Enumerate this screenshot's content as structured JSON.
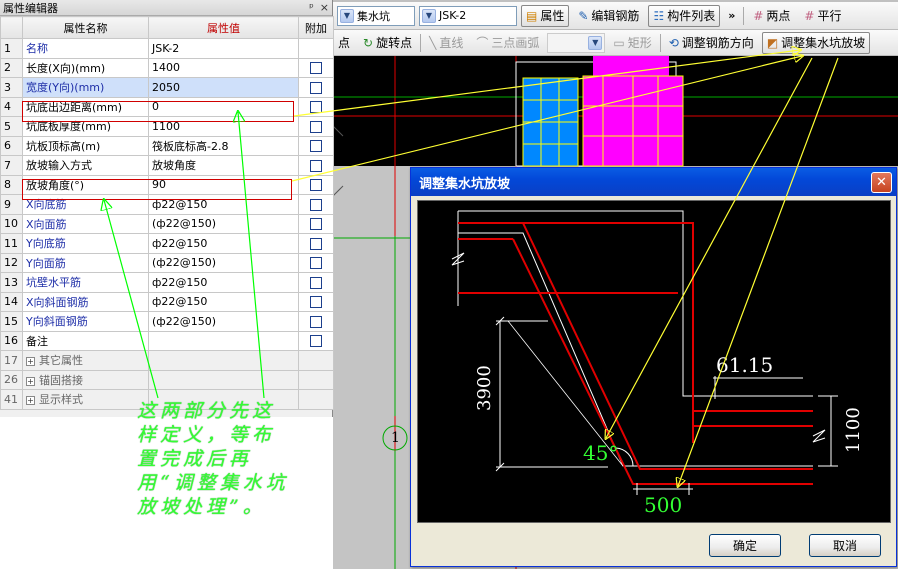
{
  "panel": {
    "title": "属性编辑器",
    "pin_glyph": "ᵖ",
    "close_glyph": "×",
    "headers": {
      "name": "属性名称",
      "value": "属性值",
      "attach": "附加"
    },
    "rows": [
      {
        "num": "1",
        "name": "名称",
        "value": "JSK-2",
        "blue": true,
        "checkbox": false
      },
      {
        "num": "2",
        "name": "长度(X向)(mm)",
        "value": "1400",
        "blue": false,
        "checkbox": true
      },
      {
        "num": "3",
        "name": "宽度(Y向)(mm)",
        "value": "2050",
        "blue": false,
        "checkbox": true
      },
      {
        "num": "4",
        "name": "坑底出边距离(mm)",
        "value": "0",
        "blue": false,
        "checkbox": true
      },
      {
        "num": "5",
        "name": "坑底板厚度(mm)",
        "value": "1100",
        "blue": false,
        "checkbox": true
      },
      {
        "num": "6",
        "name": "坑板顶标高(m)",
        "value": "筏板底标高-2.8",
        "blue": false,
        "checkbox": true
      },
      {
        "num": "7",
        "name": "放坡输入方式",
        "value": "放坡角度",
        "blue": false,
        "checkbox": true
      },
      {
        "num": "8",
        "name": "放坡角度(°)",
        "value": "90",
        "blue": false,
        "checkbox": true
      },
      {
        "num": "9",
        "name": "X向底筋",
        "value": "ф22@150",
        "blue": true,
        "checkbox": true
      },
      {
        "num": "10",
        "name": "X向面筋",
        "value": "(ф22@150)",
        "blue": true,
        "checkbox": true
      },
      {
        "num": "11",
        "name": "Y向底筋",
        "value": "ф22@150",
        "blue": true,
        "checkbox": true
      },
      {
        "num": "12",
        "name": "Y向面筋",
        "value": "(ф22@150)",
        "blue": true,
        "checkbox": true
      },
      {
        "num": "13",
        "name": "坑壁水平筋",
        "value": "ф22@150",
        "blue": true,
        "checkbox": true
      },
      {
        "num": "14",
        "name": "X向斜面钢筋",
        "value": "ф22@150",
        "blue": true,
        "checkbox": true
      },
      {
        "num": "15",
        "name": "Y向斜面钢筋",
        "value": "(ф22@150)",
        "blue": true,
        "checkbox": true
      },
      {
        "num": "16",
        "name": "备注",
        "value": "",
        "blue": false,
        "checkbox": true
      }
    ],
    "groups": [
      {
        "num": "17",
        "name": "其它属性"
      },
      {
        "num": "26",
        "name": "锚固搭接"
      },
      {
        "num": "41",
        "name": "显示样式"
      }
    ]
  },
  "toolbar1": {
    "combo1": "集水坑",
    "combo2": "JSK-2",
    "attr_btn": "属性",
    "edit_rebar_btn": "编辑钢筋",
    "component_list_btn": "构件列表",
    "more": "»",
    "two_point_btn": "两点",
    "parallel_btn": "平行"
  },
  "toolbar2": {
    "point_btn": "点",
    "rotate_point_btn": "旋转点",
    "line_btn": "直线",
    "arc_btn": "三点画弧",
    "rect_btn": "矩形",
    "adjust_dir_btn": "调整钢筋方向",
    "adjust_slope_btn": "调整集水坑放坡"
  },
  "cad": {
    "axis_label": "1"
  },
  "dialog": {
    "title": "调整集水坑放坡",
    "close_glyph": "✕",
    "dim_height": "3900",
    "dim_cover": "61.15",
    "dim_thick": "1100",
    "dim_width": "500",
    "angle_label": "45°",
    "ok_btn": "确定",
    "cancel_btn": "取消"
  },
  "annotation": {
    "text": "这两部分先这样定义，等布置完成后再用“调整集水坑放坡处理”。"
  },
  "colors": {
    "highlight_box": "#d00000",
    "annotation_text": "#33ff33",
    "arrow_green": "#00ff00",
    "arrow_yellow": "#ffff33",
    "rebar_red": "#e00000",
    "magenta_block": "#ff00ff",
    "blue_block": "#0088ff"
  }
}
